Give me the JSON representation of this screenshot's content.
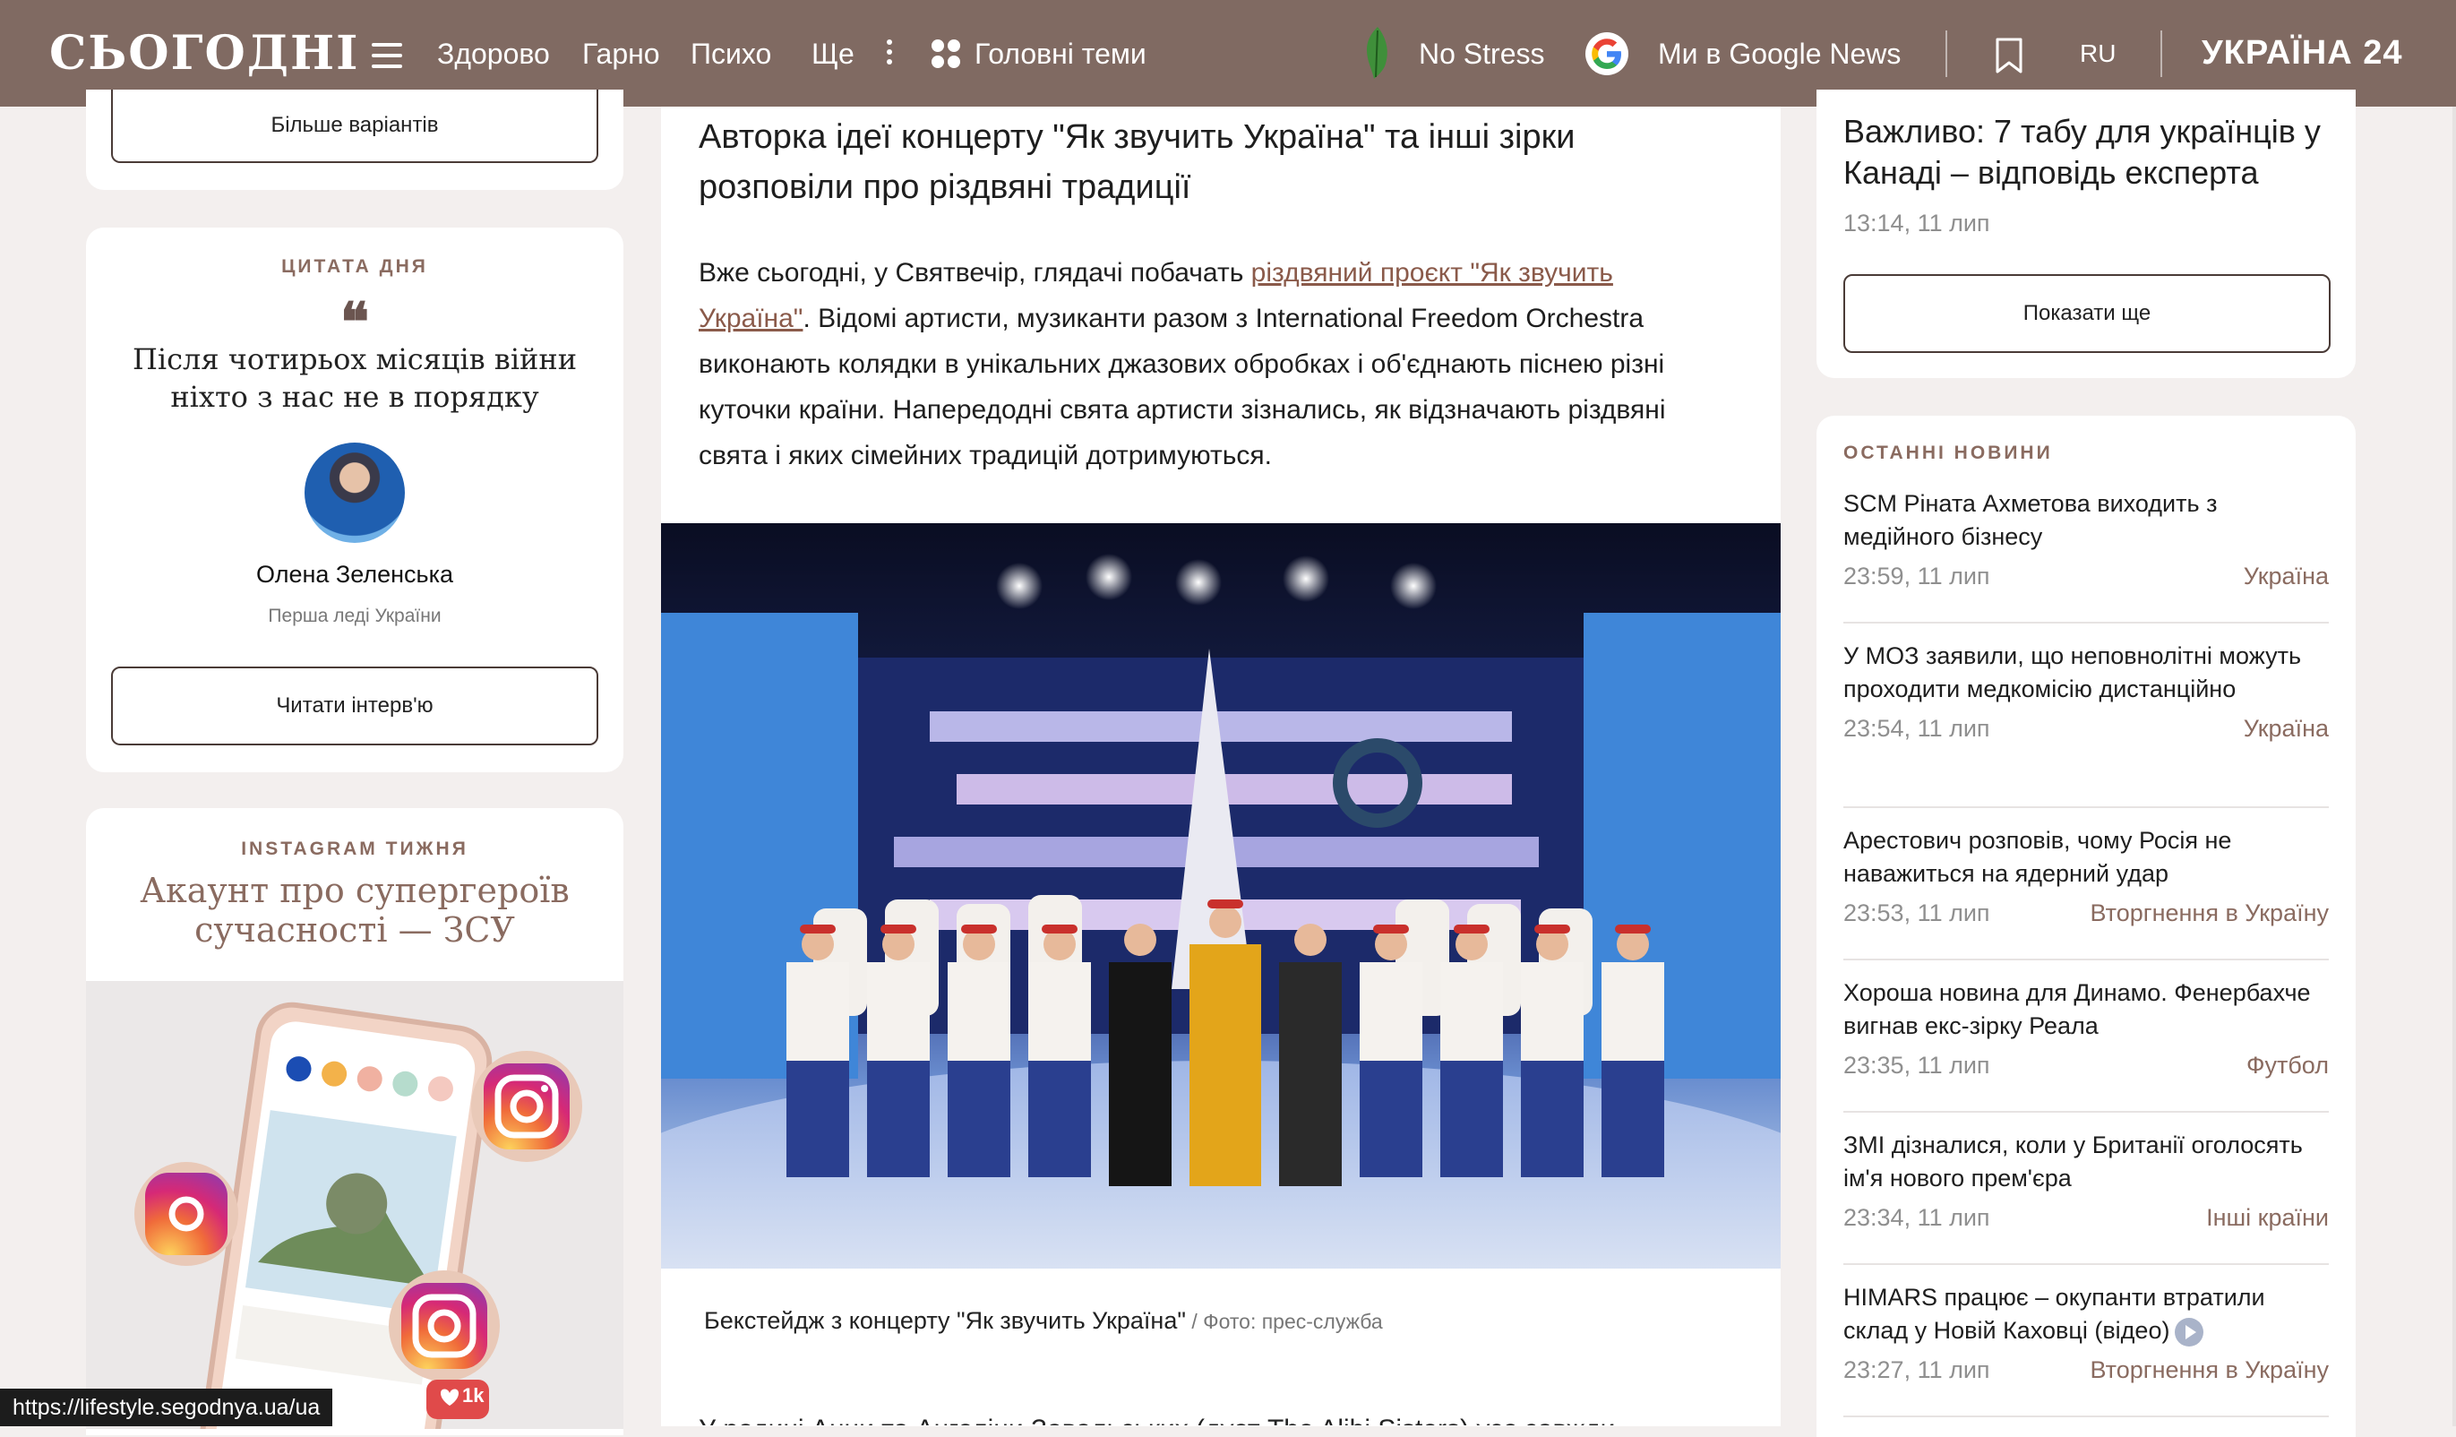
{
  "header": {
    "logo": "СЬОГОДНІ",
    "nav": [
      "Здорово",
      "Гарно",
      "Психо",
      "Ще"
    ],
    "topics": "Головні теми",
    "no_stress": "No Stress",
    "google_news": "Ми в Google News",
    "lang": "RU",
    "partner": "УКРАЇНА 24"
  },
  "left": {
    "more_options": "Більше варіантів",
    "quote_kicker": "ЦИТАТА ДНЯ",
    "quote_mark": "❝",
    "quote_text": "Після чотирьох місяців війни ніхто з нас не в порядку",
    "person_name": "Олена Зеленська",
    "person_role": "Перша леді України",
    "read_interview": "Читати інтерв'ю",
    "insta_kicker": "INSTAGRAM ТИЖНЯ",
    "insta_title": "Акаунт про супергероїв сучасності — ЗСУ",
    "insta_likes": "1k"
  },
  "article": {
    "heading": "Авторка ідеї концерту \"Як звучить Україна\" та інші зірки розповіли про різдвяні традиції",
    "body_1": "Вже сьогодні, у Святвечір, глядачі побачать ",
    "body_link": "різдвяний проєкт \"Як звучить Україна\"",
    "body_2": ". Відомі артисти, музиканти разом з International Freedom Orchestra виконають колядки в унікальних джазових обробках і об'єднають піснею різні куточки країни. Напередодні свята артисти зізнались, як відзначають різдвяні свята і яких сімейних традицій дотримуються.",
    "caption": "Бекстейдж з концерту \"Як звучить Україна\"",
    "caption_source": " / Фото: прес-служба",
    "next_line": "У родині Анни та Ангеліни Завальських (дует The Alibi Sisters) усе завжди"
  },
  "right": {
    "top_title": "Важливо: 7 табу для українців у Канаді – відповідь експерта",
    "top_meta": "13:14, 11 лип",
    "show_more": "Показати ще",
    "latest_kicker": "ОСТАННІ НОВИНИ",
    "news": [
      {
        "title": "SCM Ріната Ахметова виходить з медійного бізнесу",
        "time": "23:59, 11 лип",
        "cat": "Україна"
      },
      {
        "title": "У МОЗ заявили, що неповнолітні можуть проходити медкомісію дистанційно",
        "time": "23:54, 11 лип",
        "cat": "Україна"
      },
      {
        "title": "Арестович розповів, чому Росія не наважиться на ядерний удар",
        "time": "23:53, 11 лип",
        "cat": "Вторгнення в Україну"
      },
      {
        "title": "Хороша новина для Динамо. Фенербахче вигнав екс-зірку Реала",
        "time": "23:35, 11 лип",
        "cat": "Футбол"
      },
      {
        "title": "ЗМІ дізналися, коли у Британії оголосять ім'я нового прем'єра",
        "time": "23:34, 11 лип",
        "cat": "Інші країни"
      },
      {
        "title": "HIMARS працює – окупанти втратили склад у Новій Каховці (відео)",
        "time": "23:27, 11 лип",
        "cat": "Вторгнення в Україну"
      }
    ]
  },
  "status_url": "https://lifestyle.segodnya.ua/ua"
}
